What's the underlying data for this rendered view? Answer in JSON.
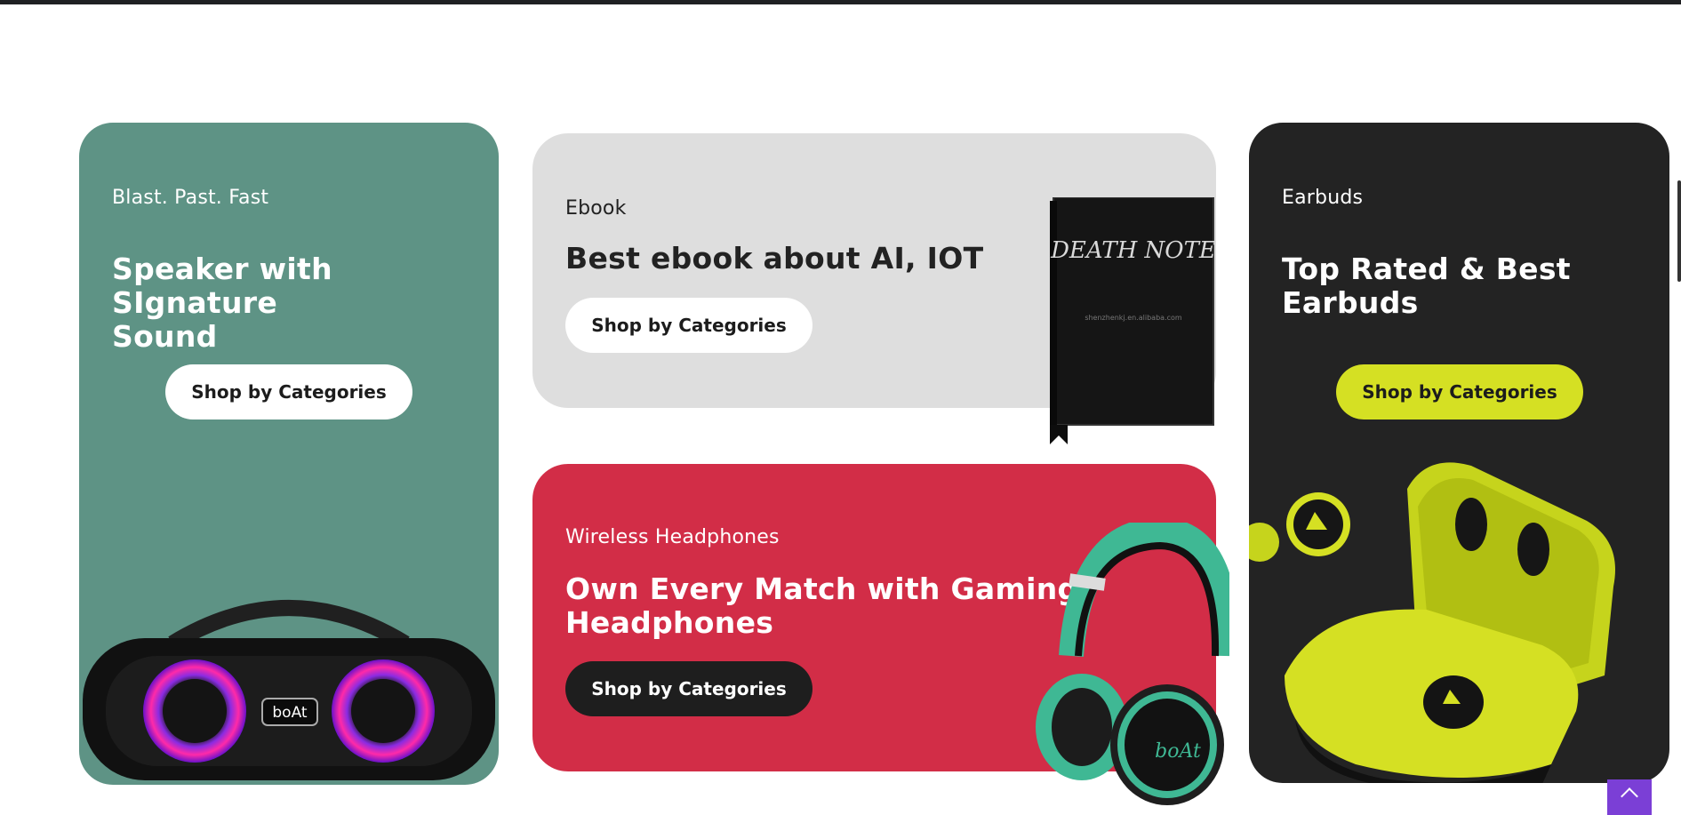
{
  "colors": {
    "speaker_card": "#5e9385",
    "ebook_card": "#dedede",
    "headphones_card": "#d22d47",
    "earbuds_card": "#232323",
    "lime_accent": "#d5e023",
    "scroll_button": "#7b3fd6"
  },
  "cards": {
    "speaker": {
      "eyebrow": "Blast. Past. Fast",
      "title_line1": "Speaker with SIgnature",
      "title_line2": "Sound",
      "button": "Shop by Categories",
      "brand_badge": "boAt"
    },
    "ebook": {
      "eyebrow": "Ebook",
      "title": "Best ebook about AI, IOT",
      "button": "Shop by Categories",
      "book_cover_title": "DEATH NOTE",
      "book_cover_small": "shenzhenkj.en.alibaba.com"
    },
    "headphones": {
      "eyebrow": "Wireless Headphones",
      "title_line1": "Own Every Match with Gaming",
      "title_line2": "Headphones",
      "button": "Shop by Categories",
      "brand_badge": "boAt"
    },
    "earbuds": {
      "eyebrow": "Earbuds",
      "title_line1": "Top Rated & Best",
      "title_line2": "Earbuds",
      "button": "Shop by Categories"
    }
  },
  "icons": {
    "scroll_top": "chevron-up-icon"
  }
}
